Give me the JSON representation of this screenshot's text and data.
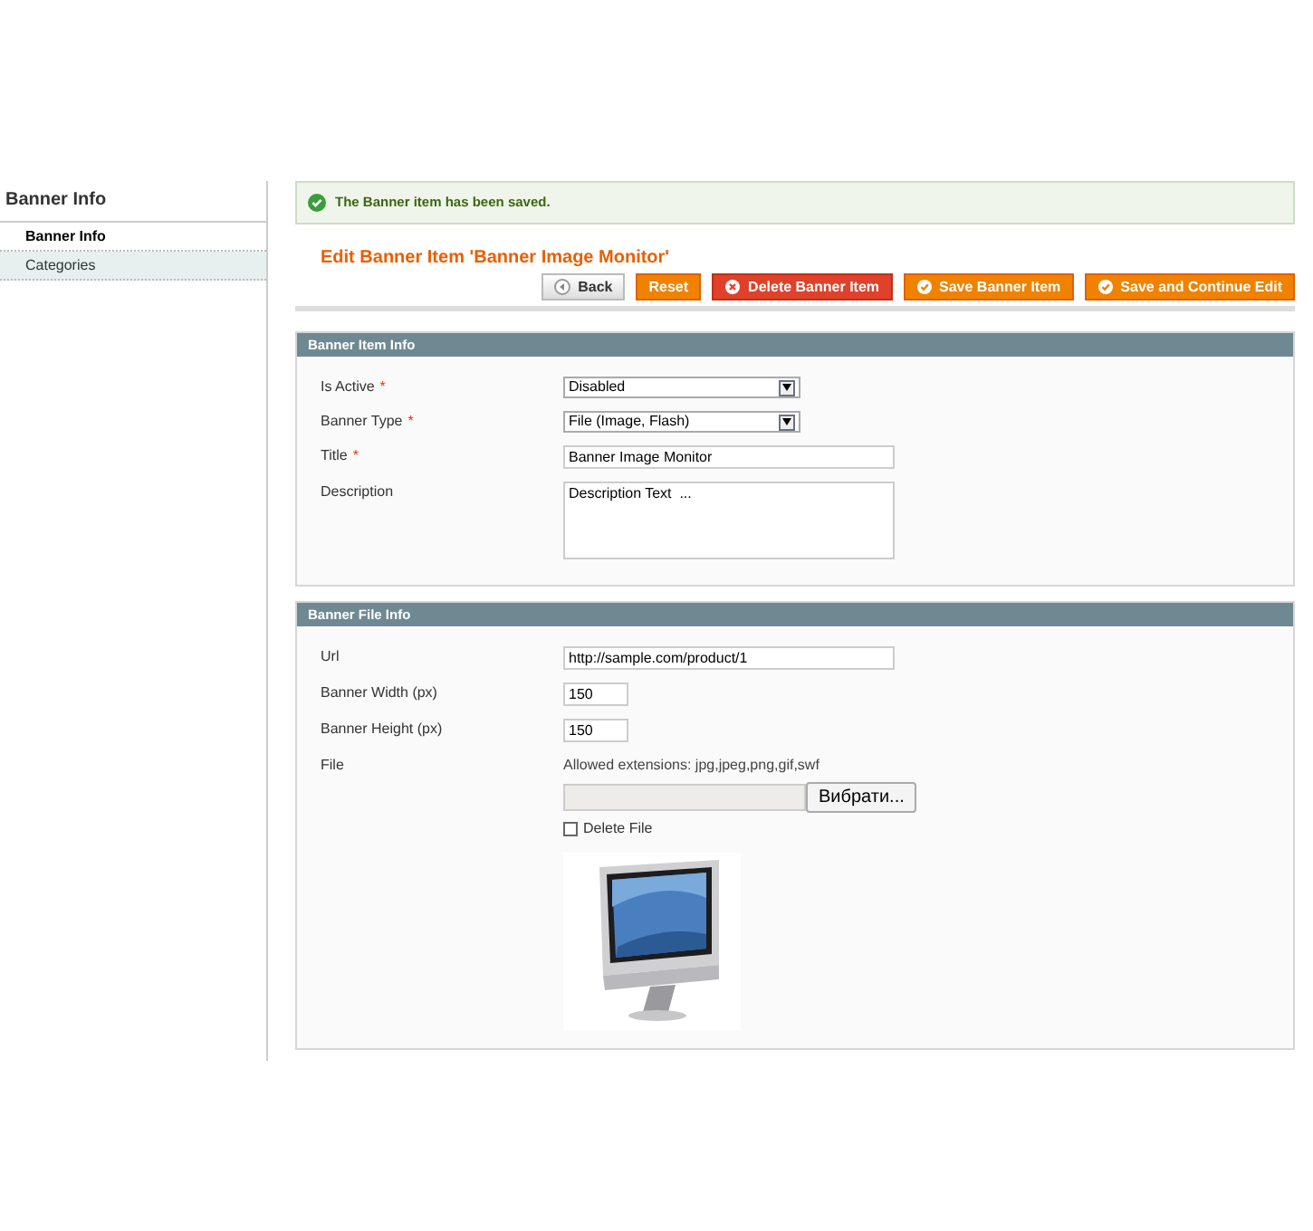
{
  "sidebar": {
    "title": "Banner Info",
    "tabs": [
      {
        "label": "Banner Info",
        "selected": true
      },
      {
        "label": "Categories",
        "selected": false
      }
    ]
  },
  "message": {
    "text": "The Banner item has been saved."
  },
  "page_title": "Edit Banner Item 'Banner Image Monitor'",
  "buttons": [
    {
      "kind": "back",
      "label": "Back"
    },
    {
      "kind": "reset",
      "label": "Reset"
    },
    {
      "kind": "delete",
      "label": "Delete Banner Item"
    },
    {
      "kind": "save",
      "label": "Save Banner Item"
    },
    {
      "kind": "save",
      "label": "Save and Continue Edit"
    }
  ],
  "sections": [
    {
      "title": "Banner Item Info",
      "fields": [
        {
          "kind": "select",
          "label": "Is Active",
          "required_mark": "*",
          "value": "Disabled"
        },
        {
          "kind": "select",
          "label": "Banner Type",
          "required_mark": "*",
          "value": "File (Image, Flash)"
        },
        {
          "kind": "text",
          "label": "Title",
          "required_mark": "*",
          "value": "Banner Image Monitor"
        },
        {
          "kind": "textarea",
          "label": "Description",
          "value": "Description Text  ..."
        }
      ]
    },
    {
      "title": "Banner File Info",
      "fields": [
        {
          "kind": "text",
          "label": "Url",
          "value": "http://sample.com/product/1"
        },
        {
          "kind": "short",
          "label": "Banner Width (px)",
          "value": "150"
        },
        {
          "kind": "short",
          "label": "Banner Height (px)",
          "value": "150"
        },
        {
          "kind": "file",
          "label": "File",
          "note": "Allowed extensions: jpg,jpeg,png,gif,swf",
          "browse": "Вибрати...",
          "delete_label": "Delete File",
          "delete_checked": false
        }
      ]
    }
  ]
}
